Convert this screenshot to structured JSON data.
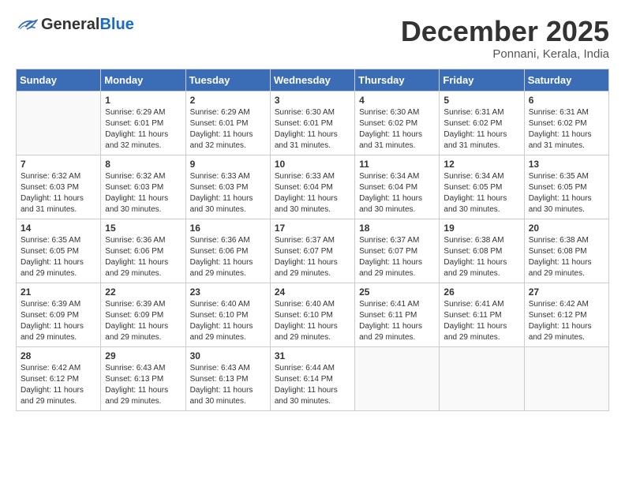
{
  "header": {
    "logo_general": "General",
    "logo_blue": "Blue",
    "month_title": "December 2025",
    "location": "Ponnani, Kerala, India"
  },
  "weekdays": [
    "Sunday",
    "Monday",
    "Tuesday",
    "Wednesday",
    "Thursday",
    "Friday",
    "Saturday"
  ],
  "weeks": [
    [
      {
        "day": "",
        "empty": true
      },
      {
        "day": "1",
        "sunrise": "Sunrise: 6:29 AM",
        "sunset": "Sunset: 6:01 PM",
        "daylight": "Daylight: 11 hours and 32 minutes."
      },
      {
        "day": "2",
        "sunrise": "Sunrise: 6:29 AM",
        "sunset": "Sunset: 6:01 PM",
        "daylight": "Daylight: 11 hours and 32 minutes."
      },
      {
        "day": "3",
        "sunrise": "Sunrise: 6:30 AM",
        "sunset": "Sunset: 6:01 PM",
        "daylight": "Daylight: 11 hours and 31 minutes."
      },
      {
        "day": "4",
        "sunrise": "Sunrise: 6:30 AM",
        "sunset": "Sunset: 6:02 PM",
        "daylight": "Daylight: 11 hours and 31 minutes."
      },
      {
        "day": "5",
        "sunrise": "Sunrise: 6:31 AM",
        "sunset": "Sunset: 6:02 PM",
        "daylight": "Daylight: 11 hours and 31 minutes."
      },
      {
        "day": "6",
        "sunrise": "Sunrise: 6:31 AM",
        "sunset": "Sunset: 6:02 PM",
        "daylight": "Daylight: 11 hours and 31 minutes."
      }
    ],
    [
      {
        "day": "7",
        "sunrise": "Sunrise: 6:32 AM",
        "sunset": "Sunset: 6:03 PM",
        "daylight": "Daylight: 11 hours and 31 minutes."
      },
      {
        "day": "8",
        "sunrise": "Sunrise: 6:32 AM",
        "sunset": "Sunset: 6:03 PM",
        "daylight": "Daylight: 11 hours and 30 minutes."
      },
      {
        "day": "9",
        "sunrise": "Sunrise: 6:33 AM",
        "sunset": "Sunset: 6:03 PM",
        "daylight": "Daylight: 11 hours and 30 minutes."
      },
      {
        "day": "10",
        "sunrise": "Sunrise: 6:33 AM",
        "sunset": "Sunset: 6:04 PM",
        "daylight": "Daylight: 11 hours and 30 minutes."
      },
      {
        "day": "11",
        "sunrise": "Sunrise: 6:34 AM",
        "sunset": "Sunset: 6:04 PM",
        "daylight": "Daylight: 11 hours and 30 minutes."
      },
      {
        "day": "12",
        "sunrise": "Sunrise: 6:34 AM",
        "sunset": "Sunset: 6:05 PM",
        "daylight": "Daylight: 11 hours and 30 minutes."
      },
      {
        "day": "13",
        "sunrise": "Sunrise: 6:35 AM",
        "sunset": "Sunset: 6:05 PM",
        "daylight": "Daylight: 11 hours and 30 minutes."
      }
    ],
    [
      {
        "day": "14",
        "sunrise": "Sunrise: 6:35 AM",
        "sunset": "Sunset: 6:05 PM",
        "daylight": "Daylight: 11 hours and 29 minutes."
      },
      {
        "day": "15",
        "sunrise": "Sunrise: 6:36 AM",
        "sunset": "Sunset: 6:06 PM",
        "daylight": "Daylight: 11 hours and 29 minutes."
      },
      {
        "day": "16",
        "sunrise": "Sunrise: 6:36 AM",
        "sunset": "Sunset: 6:06 PM",
        "daylight": "Daylight: 11 hours and 29 minutes."
      },
      {
        "day": "17",
        "sunrise": "Sunrise: 6:37 AM",
        "sunset": "Sunset: 6:07 PM",
        "daylight": "Daylight: 11 hours and 29 minutes."
      },
      {
        "day": "18",
        "sunrise": "Sunrise: 6:37 AM",
        "sunset": "Sunset: 6:07 PM",
        "daylight": "Daylight: 11 hours and 29 minutes."
      },
      {
        "day": "19",
        "sunrise": "Sunrise: 6:38 AM",
        "sunset": "Sunset: 6:08 PM",
        "daylight": "Daylight: 11 hours and 29 minutes."
      },
      {
        "day": "20",
        "sunrise": "Sunrise: 6:38 AM",
        "sunset": "Sunset: 6:08 PM",
        "daylight": "Daylight: 11 hours and 29 minutes."
      }
    ],
    [
      {
        "day": "21",
        "sunrise": "Sunrise: 6:39 AM",
        "sunset": "Sunset: 6:09 PM",
        "daylight": "Daylight: 11 hours and 29 minutes."
      },
      {
        "day": "22",
        "sunrise": "Sunrise: 6:39 AM",
        "sunset": "Sunset: 6:09 PM",
        "daylight": "Daylight: 11 hours and 29 minutes."
      },
      {
        "day": "23",
        "sunrise": "Sunrise: 6:40 AM",
        "sunset": "Sunset: 6:10 PM",
        "daylight": "Daylight: 11 hours and 29 minutes."
      },
      {
        "day": "24",
        "sunrise": "Sunrise: 6:40 AM",
        "sunset": "Sunset: 6:10 PM",
        "daylight": "Daylight: 11 hours and 29 minutes."
      },
      {
        "day": "25",
        "sunrise": "Sunrise: 6:41 AM",
        "sunset": "Sunset: 6:11 PM",
        "daylight": "Daylight: 11 hours and 29 minutes."
      },
      {
        "day": "26",
        "sunrise": "Sunrise: 6:41 AM",
        "sunset": "Sunset: 6:11 PM",
        "daylight": "Daylight: 11 hours and 29 minutes."
      },
      {
        "day": "27",
        "sunrise": "Sunrise: 6:42 AM",
        "sunset": "Sunset: 6:12 PM",
        "daylight": "Daylight: 11 hours and 29 minutes."
      }
    ],
    [
      {
        "day": "28",
        "sunrise": "Sunrise: 6:42 AM",
        "sunset": "Sunset: 6:12 PM",
        "daylight": "Daylight: 11 hours and 29 minutes."
      },
      {
        "day": "29",
        "sunrise": "Sunrise: 6:43 AM",
        "sunset": "Sunset: 6:13 PM",
        "daylight": "Daylight: 11 hours and 29 minutes."
      },
      {
        "day": "30",
        "sunrise": "Sunrise: 6:43 AM",
        "sunset": "Sunset: 6:13 PM",
        "daylight": "Daylight: 11 hours and 30 minutes."
      },
      {
        "day": "31",
        "sunrise": "Sunrise: 6:44 AM",
        "sunset": "Sunset: 6:14 PM",
        "daylight": "Daylight: 11 hours and 30 minutes."
      },
      {
        "day": "",
        "empty": true
      },
      {
        "day": "",
        "empty": true
      },
      {
        "day": "",
        "empty": true
      }
    ]
  ]
}
